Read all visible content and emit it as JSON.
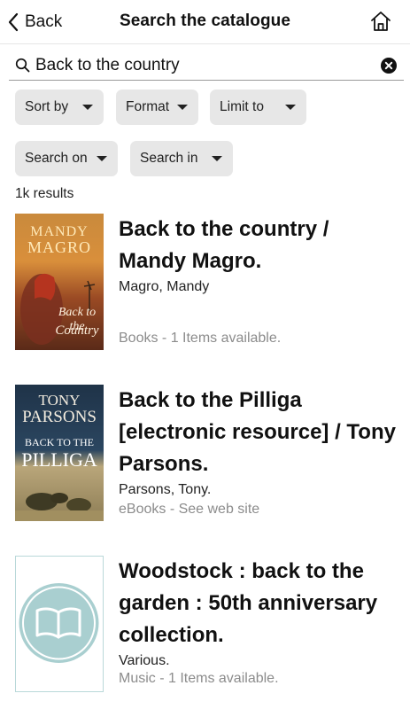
{
  "header": {
    "back_label": "Back",
    "title": "Search the catalogue"
  },
  "search": {
    "query": "Back to the country"
  },
  "filters": [
    {
      "label": "Sort by"
    },
    {
      "label": "Format"
    },
    {
      "label": "Limit to"
    },
    {
      "label": "Search on"
    },
    {
      "label": "Search in"
    }
  ],
  "results_count": "1k results",
  "results": [
    {
      "title": "Back to the country / Mandy Magro.",
      "author": "Magro, Mandy",
      "availability": "Books - 1 Items available.",
      "cover": {
        "line1": "MANDY",
        "line2": "MAGRO",
        "script1": "Back to the",
        "script2": "Country"
      }
    },
    {
      "title": "Back to the Pilliga [electronic resource] / Tony Parsons.",
      "author": "Parsons, Tony.",
      "availability": "eBooks - See web site",
      "cover": {
        "line1": "TONY",
        "line2": "PARSONS",
        "line3": "BACK TO THE",
        "line4": "PILLIGA"
      }
    },
    {
      "title": "Woodstock : back to the garden : 50th anniversary collection.",
      "author": "Various.",
      "availability": "Music - 1 Items available.",
      "cover": {
        "icon": "open-book-icon"
      }
    }
  ],
  "colors": {
    "chip_bg": "#e7e7e7",
    "muted_text": "#8c8c8c",
    "placeholder_teal": "#a9cfd0"
  }
}
